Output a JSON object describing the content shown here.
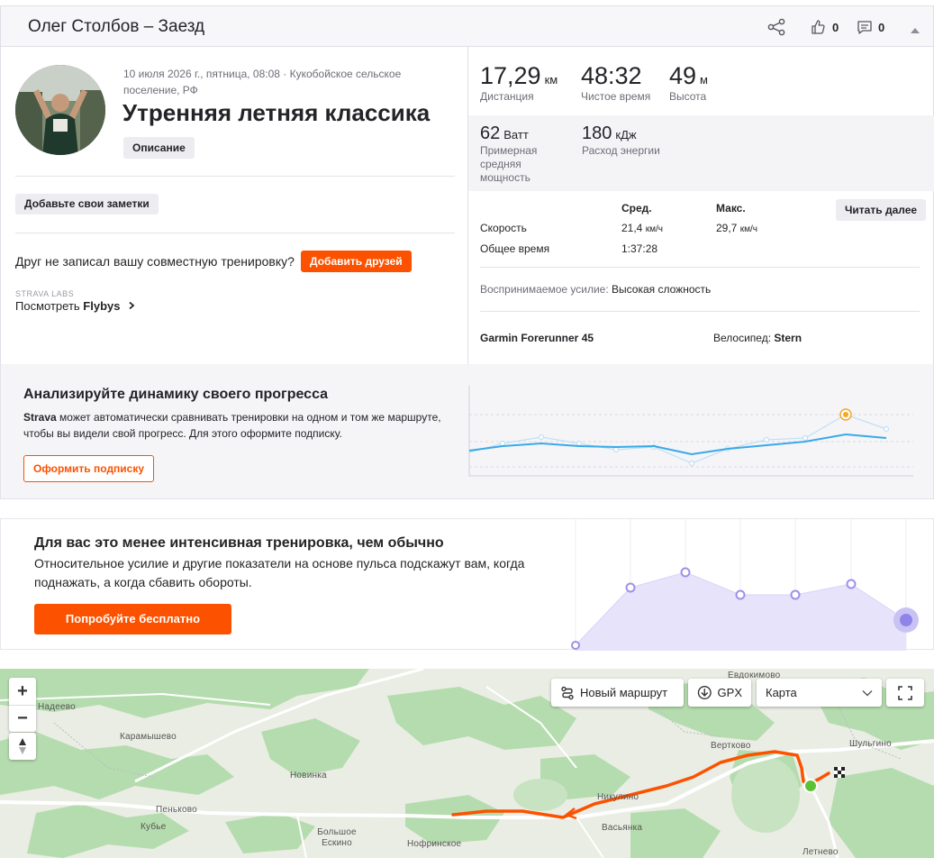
{
  "header": {
    "title": "Олег Столбов – Заезд",
    "kudos_count": "0",
    "comment_count": "0"
  },
  "activity": {
    "meta": "10 июля 2026 г., пятница, 08:08 · Кукобойское сельское поселение, РФ",
    "title": "Утренняя летняя классика",
    "description_button": "Описание",
    "notes_button": "Добавьте свои заметки",
    "friend_prompt": "Друг не записал вашу совместную тренировку?",
    "add_friends_button": "Добавить друзей",
    "labs_tag": "STRAVA LABS",
    "flybys_prefix": "Посмотреть ",
    "flybys_name": "Flybys"
  },
  "stats": {
    "primary": [
      {
        "value": "17,29",
        "unit": "км",
        "label": "Дистанция"
      },
      {
        "value": "48:32",
        "unit": "",
        "label": "Чистое время"
      },
      {
        "value": "49",
        "unit": "м",
        "label": "Высота"
      }
    ],
    "secondary": [
      {
        "value": "62",
        "unit": "Ватт",
        "label": "Примерная средняя мощность"
      },
      {
        "value": "180",
        "unit": "кДж",
        "label": "Расход энергии"
      }
    ],
    "table": {
      "avg_header": "Сред.",
      "max_header": "Макс.",
      "speed_label": "Скорость",
      "speed_avg": "21,4",
      "speed_avg_unit": "км/ч",
      "speed_max": "29,7",
      "speed_max_unit": "км/ч",
      "elapsed_label": "Общее время",
      "elapsed_avg": "1:37:28"
    },
    "read_more_button": "Читать далее",
    "effort_label": "Воспринимаемое усилие: ",
    "effort_value": "Высокая сложность",
    "device": "Garmin Forerunner 45",
    "bike_label": "Велосипед: ",
    "bike_name": "Stern"
  },
  "progress_promo": {
    "title": "Анализируйте динамику своего прогресса",
    "text_brand": "Strava",
    "text_rest": " может автоматически сравнивать тренировки на одном и том же маршруте, чтобы вы видели свой прогресс. Для этого оформите подписку.",
    "button": "Оформить подписку"
  },
  "intensity_promo": {
    "title": "Для вас это менее интенсивная тренировка, чем обычно",
    "text": "Относительное усилие и другие показатели на основе пульса подскажут вам, когда поднажать, а когда сбавить обороты.",
    "button": "Попробуйте бесплатно"
  },
  "map": {
    "zoom_in": "+",
    "zoom_out": "−",
    "new_route_button": "Новый маршрут",
    "gpx_button": "GPX",
    "map_type_selected": "Карта",
    "place_labels": [
      "Надеево",
      "Карамышево",
      "Новинка",
      "Пеньково",
      "Кубье",
      "Большое Ескино",
      "Нофринское",
      "Никулино",
      "Васьянка",
      "Вертково",
      "Шульгино",
      "Летнево",
      "Евдокимово"
    ]
  },
  "colors": {
    "accent": "#fc5200",
    "chart_blue": "#3aa9e8",
    "chart_purple": "#8f84e8",
    "start_green": "#5bc236"
  }
}
